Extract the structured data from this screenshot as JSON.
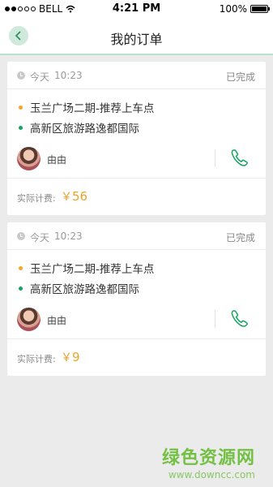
{
  "status_bar": {
    "carrier": "BELL",
    "time": "4:21 PM",
    "battery": "100%"
  },
  "header": {
    "title": "我的订单"
  },
  "orders": [
    {
      "day": "今天",
      "time": "10:23",
      "status": "已完成",
      "pickup": "玉兰广场二期-推荐上车点",
      "destination": "高新区旅游路逸都国际",
      "driver_name": "由由",
      "fee_label": "实际计费:",
      "currency": "￥",
      "fee": "56"
    },
    {
      "day": "今天",
      "time": "10:23",
      "status": "已完成",
      "pickup": "玉兰广场二期-推荐上车点",
      "destination": "高新区旅游路逸都国际",
      "driver_name": "由由",
      "fee_label": "实际计费:",
      "currency": "￥",
      "fee": "9"
    }
  ],
  "watermark": {
    "title": "绿色资源网",
    "url": "www.downcc.com"
  },
  "colors": {
    "accent_green": "#16a45e",
    "pickup_orange": "#f5a623",
    "fee_orange": "#e6a52a"
  }
}
